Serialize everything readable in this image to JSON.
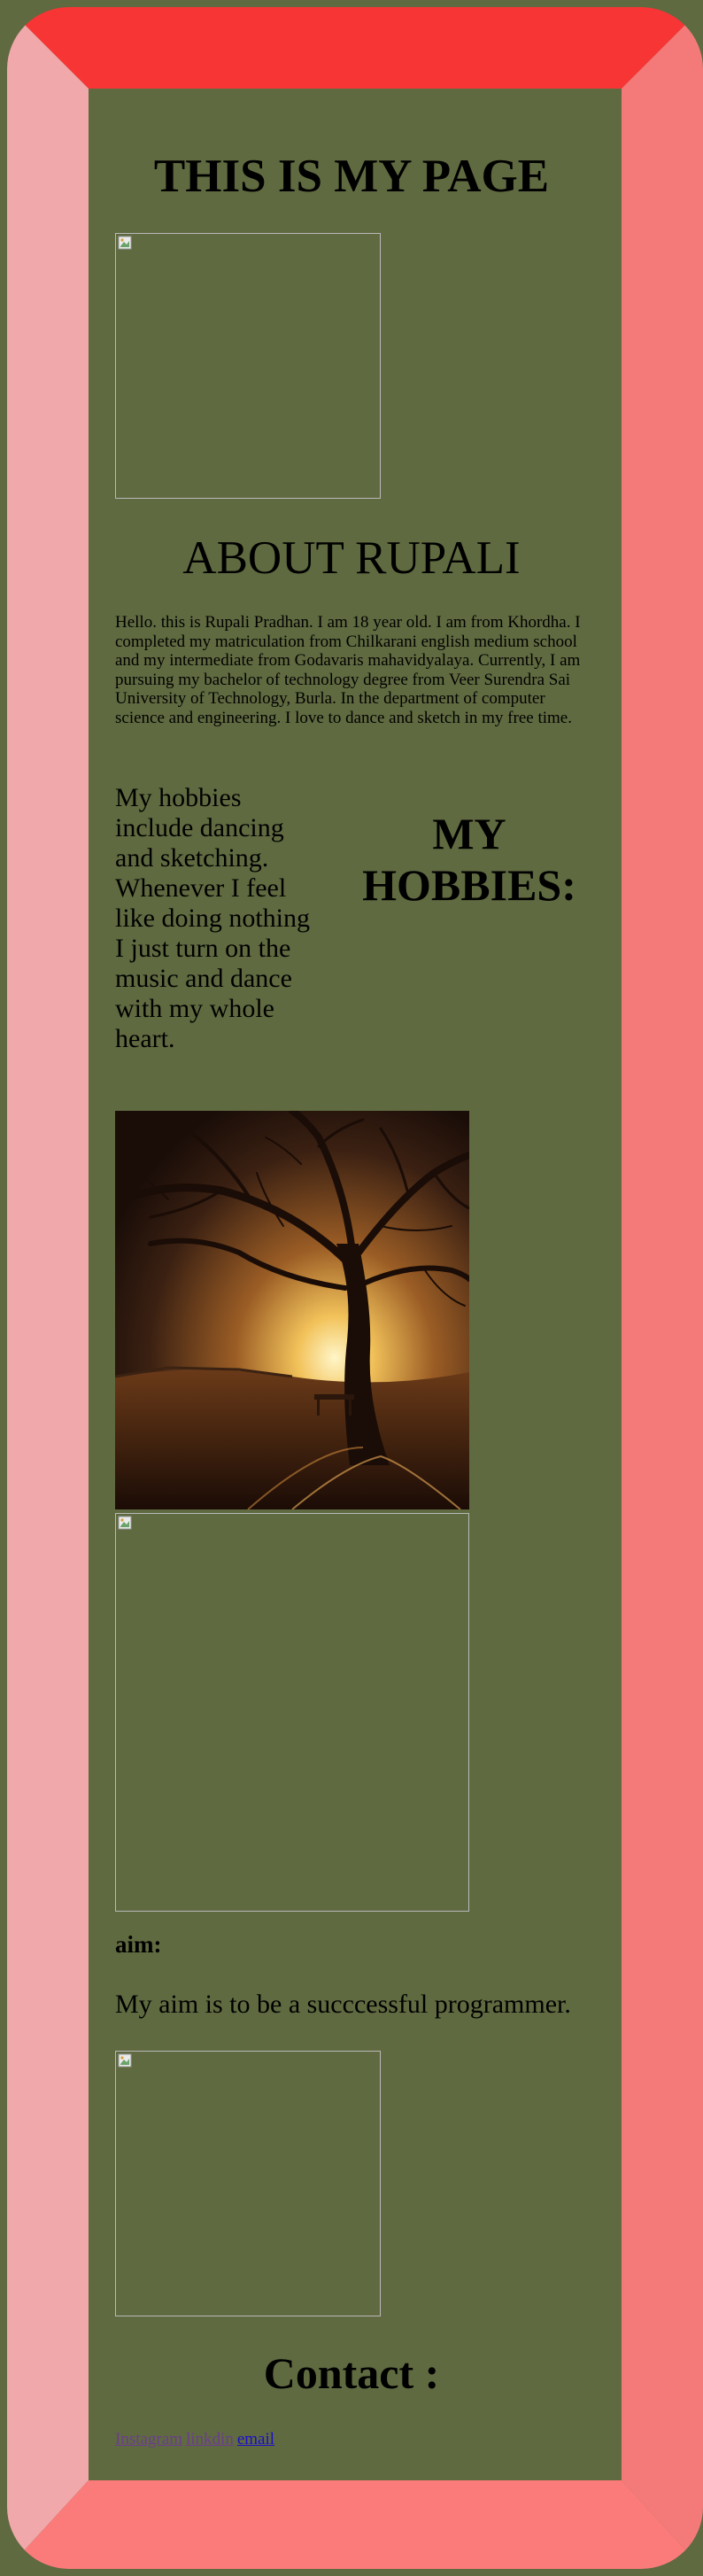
{
  "page": {
    "title": "THIS IS MY PAGE"
  },
  "about": {
    "title": "ABOUT RUPALI",
    "text": "Hello. this is Rupali Pradhan. I am 18 year old. I am from Khordha. I completed my matriculation from Chilkarani english medium school and my intermediate from Godavaris mahavidyalaya. Currently, I am pursuing my bachelor of technology degree from Veer Surendra Sai University of Technology, Burla. In the department of computer science and engineering. I love to dance and sketch in my free time."
  },
  "hobbies": {
    "title": "MY HOBBIES:",
    "text": "My hobbies include dancing and sketching. Whenever I feel like doing nothing I just turn on the music and dance with my whole heart."
  },
  "aim": {
    "label": "aim:",
    "text": "My aim is to be a succcessful programmer."
  },
  "contact": {
    "title": "Contact :",
    "links": [
      {
        "label": "Instagram",
        "state": "visited"
      },
      {
        "label": "linkdin",
        "state": "visited"
      },
      {
        "label": "email",
        "state": "unvisited"
      }
    ]
  },
  "colors": {
    "background": "#5f6a40",
    "border_top": "#f73535",
    "border_left": "#f0a8aa",
    "border_right": "#f47a7a",
    "border_bottom": "#fb7b7b",
    "link_visited": "#6b3d8e",
    "link_unvisited": "#1a0dcb"
  },
  "icons": {
    "broken_image": "broken-image-icon"
  }
}
